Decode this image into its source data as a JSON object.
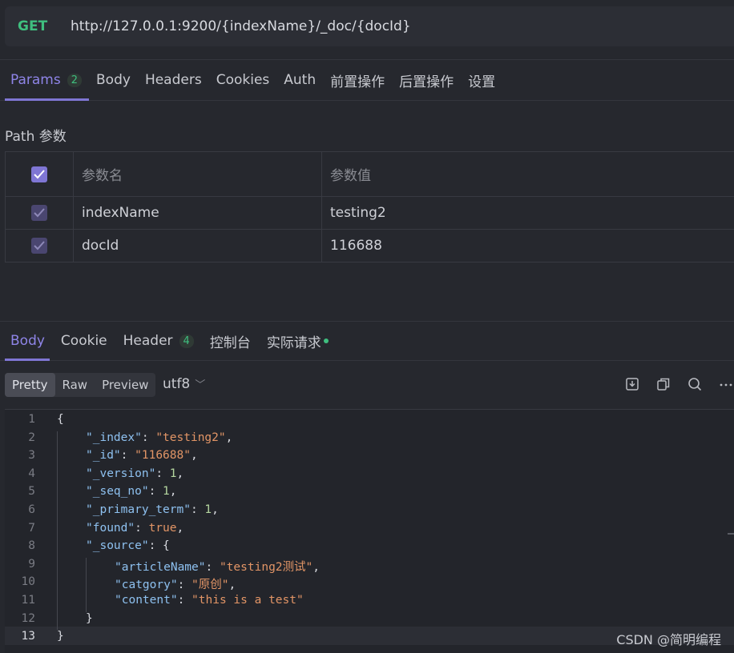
{
  "request": {
    "method": "GET",
    "url": "http://127.0.0.1:9200/{indexName}/_doc/{docId}"
  },
  "request_tabs": [
    {
      "label": "Params",
      "count": "2"
    },
    {
      "label": "Body"
    },
    {
      "label": "Headers"
    },
    {
      "label": "Cookies"
    },
    {
      "label": "Auth"
    },
    {
      "label": "前置操作"
    },
    {
      "label": "后置操作"
    },
    {
      "label": "设置"
    }
  ],
  "path_params": {
    "title": "Path 参数",
    "headers": {
      "name": "参数名",
      "value": "参数值"
    },
    "rows": [
      {
        "name": "indexName",
        "value": "testing2"
      },
      {
        "name": "docId",
        "value": "116688"
      }
    ]
  },
  "response_tabs": [
    {
      "label": "Body"
    },
    {
      "label": "Cookie"
    },
    {
      "label": "Header",
      "count": "4"
    },
    {
      "label": "控制台"
    },
    {
      "label": "实际请求"
    }
  ],
  "format_toolbar": {
    "modes": [
      "Pretty",
      "Raw",
      "Preview"
    ],
    "selected": "Pretty",
    "encoding": "utf8"
  },
  "code": {
    "line_numbers": [
      "1",
      "2",
      "3",
      "4",
      "5",
      "6",
      "7",
      "8",
      "9",
      "10",
      "11",
      "12",
      "13"
    ],
    "lines": [
      [
        {
          "t": "p",
          "v": "{"
        }
      ],
      [
        {
          "t": "k",
          "v": "\"_index\""
        },
        {
          "t": "p",
          "v": ": "
        },
        {
          "t": "s",
          "v": "\"testing2\""
        },
        {
          "t": "p",
          "v": ","
        }
      ],
      [
        {
          "t": "k",
          "v": "\"_id\""
        },
        {
          "t": "p",
          "v": ": "
        },
        {
          "t": "s",
          "v": "\"116688\""
        },
        {
          "t": "p",
          "v": ","
        }
      ],
      [
        {
          "t": "k",
          "v": "\"_version\""
        },
        {
          "t": "p",
          "v": ": "
        },
        {
          "t": "n",
          "v": "1"
        },
        {
          "t": "p",
          "v": ","
        }
      ],
      [
        {
          "t": "k",
          "v": "\"_seq_no\""
        },
        {
          "t": "p",
          "v": ": "
        },
        {
          "t": "n",
          "v": "1"
        },
        {
          "t": "p",
          "v": ","
        }
      ],
      [
        {
          "t": "k",
          "v": "\"_primary_term\""
        },
        {
          "t": "p",
          "v": ": "
        },
        {
          "t": "n",
          "v": "1"
        },
        {
          "t": "p",
          "v": ","
        }
      ],
      [
        {
          "t": "k",
          "v": "\"found\""
        },
        {
          "t": "p",
          "v": ": "
        },
        {
          "t": "b",
          "v": "true"
        },
        {
          "t": "p",
          "v": ","
        }
      ],
      [
        {
          "t": "k",
          "v": "\"_source\""
        },
        {
          "t": "p",
          "v": ": {"
        }
      ],
      [
        {
          "t": "k",
          "v": "\"articleName\""
        },
        {
          "t": "p",
          "v": ": "
        },
        {
          "t": "s",
          "v": "\"testing2测试\""
        },
        {
          "t": "p",
          "v": ","
        }
      ],
      [
        {
          "t": "k",
          "v": "\"catgory\""
        },
        {
          "t": "p",
          "v": ": "
        },
        {
          "t": "s",
          "v": "\"原创\""
        },
        {
          "t": "p",
          "v": ","
        }
      ],
      [
        {
          "t": "k",
          "v": "\"content\""
        },
        {
          "t": "p",
          "v": ": "
        },
        {
          "t": "s",
          "v": "\"this is a test\""
        }
      ],
      [
        {
          "t": "p",
          "v": "}"
        }
      ],
      [
        {
          "t": "p",
          "v": "}"
        }
      ]
    ],
    "indent_levels": [
      0,
      1,
      1,
      1,
      1,
      1,
      1,
      1,
      2,
      2,
      2,
      1,
      0
    ],
    "current_line": "13"
  },
  "watermark": "CSDN @简明编程",
  "icons": [
    "download-icon",
    "copy-icon",
    "search-icon",
    "more-icon"
  ]
}
